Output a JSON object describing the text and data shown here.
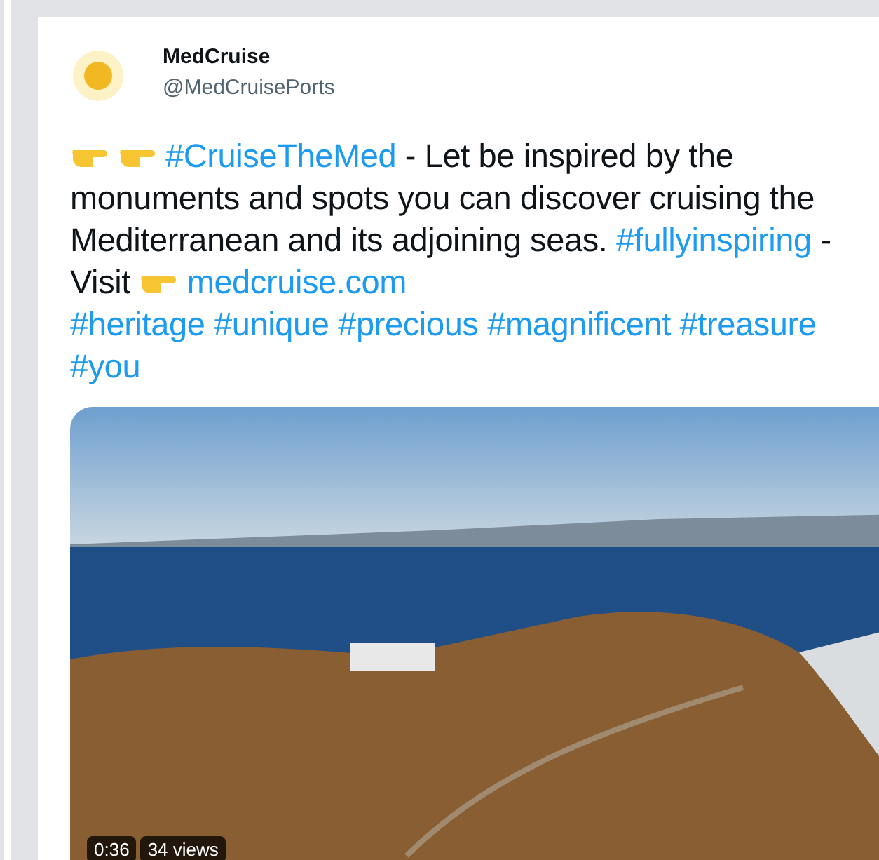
{
  "tweet": {
    "author": {
      "name": "MedCruise",
      "handle": "@MedCruisePorts"
    },
    "lines": [
      [
        {
          "kind": "emoji"
        },
        {
          "kind": "emoji"
        },
        {
          "kind": "hashtag",
          "text": "#CruiseTheMed"
        },
        {
          "kind": "text",
          "text": " - Let be inspired by the"
        }
      ],
      [
        {
          "kind": "text",
          "text": "monuments and spots you can discover cruising the"
        }
      ],
      [
        {
          "kind": "text",
          "text": "Mediterranean and its adjoining seas. "
        },
        {
          "kind": "hashtag",
          "text": "#fullyinspiring"
        },
        {
          "kind": "text",
          "text": " -"
        }
      ],
      [
        {
          "kind": "text",
          "text": "Visit "
        },
        {
          "kind": "emoji"
        },
        {
          "kind": "link",
          "text": "medcruise.com"
        }
      ],
      [
        {
          "kind": "hashtag",
          "text": "#heritage"
        },
        {
          "kind": "space"
        },
        {
          "kind": "hashtag",
          "text": "#unique"
        },
        {
          "kind": "space"
        },
        {
          "kind": "hashtag",
          "text": "#precious"
        },
        {
          "kind": "space"
        },
        {
          "kind": "hashtag",
          "text": "#magnificent"
        },
        {
          "kind": "space"
        },
        {
          "kind": "hashtag",
          "text": "#treasure"
        }
      ],
      [
        {
          "kind": "hashtag",
          "text": "#you"
        }
      ]
    ],
    "video": {
      "duration": "0:36",
      "views": "34 views"
    }
  }
}
